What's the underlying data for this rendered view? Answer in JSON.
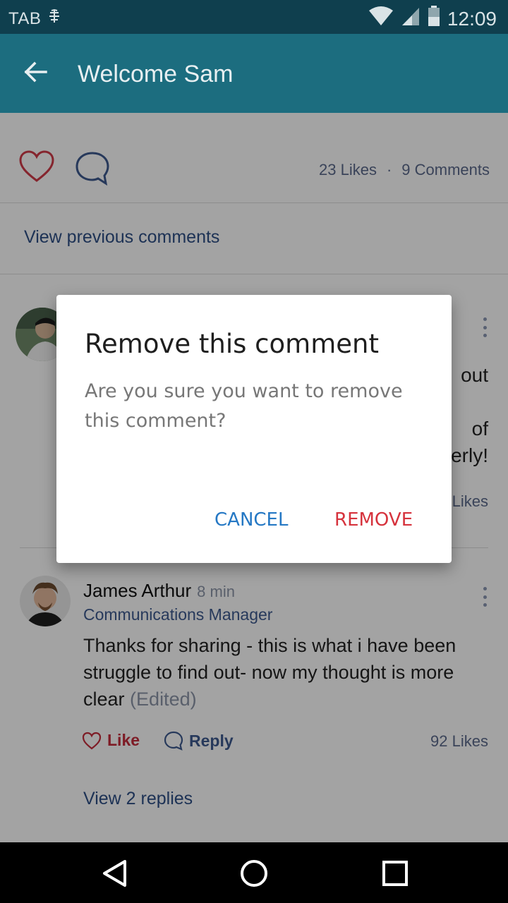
{
  "status_bar": {
    "carrier_label": "TAB",
    "time": "12:09",
    "icons": [
      "sync-icon",
      "wifi-icon",
      "signal-icon",
      "battery-icon"
    ]
  },
  "app_bar": {
    "title": "Welcome Sam",
    "back_icon": "arrow-back-icon"
  },
  "post_stats": {
    "likes": "23 Likes",
    "separator": "·",
    "comments": "9 Comments"
  },
  "prev_comments_label": "View previous comments",
  "comment_1": {
    "visible_fragments": [
      "out",
      "of",
      "erly!"
    ],
    "likes": "Likes"
  },
  "comment_2": {
    "name": "James Arthur",
    "time": "8 min",
    "role": "Communications Manager",
    "text": "Thanks for sharing - this is what i have been struggle to find out- now my thought is more clear",
    "edited": "(Edited)",
    "like_label": "Like",
    "reply_label": "Reply",
    "likes": "92 Likes",
    "view_replies": "View 2 replies"
  },
  "dialog": {
    "title": "Remove this comment",
    "message": "Are you sure you want to remove this comment?",
    "cancel_label": "CANCEL",
    "remove_label": "REMOVE"
  },
  "colors": {
    "status_bar": "#0f3f4e",
    "app_bar": "#1c6d7f",
    "accent_red": "#d6333d",
    "accent_blue": "#2578c4",
    "link_blue": "#2e4f86"
  }
}
